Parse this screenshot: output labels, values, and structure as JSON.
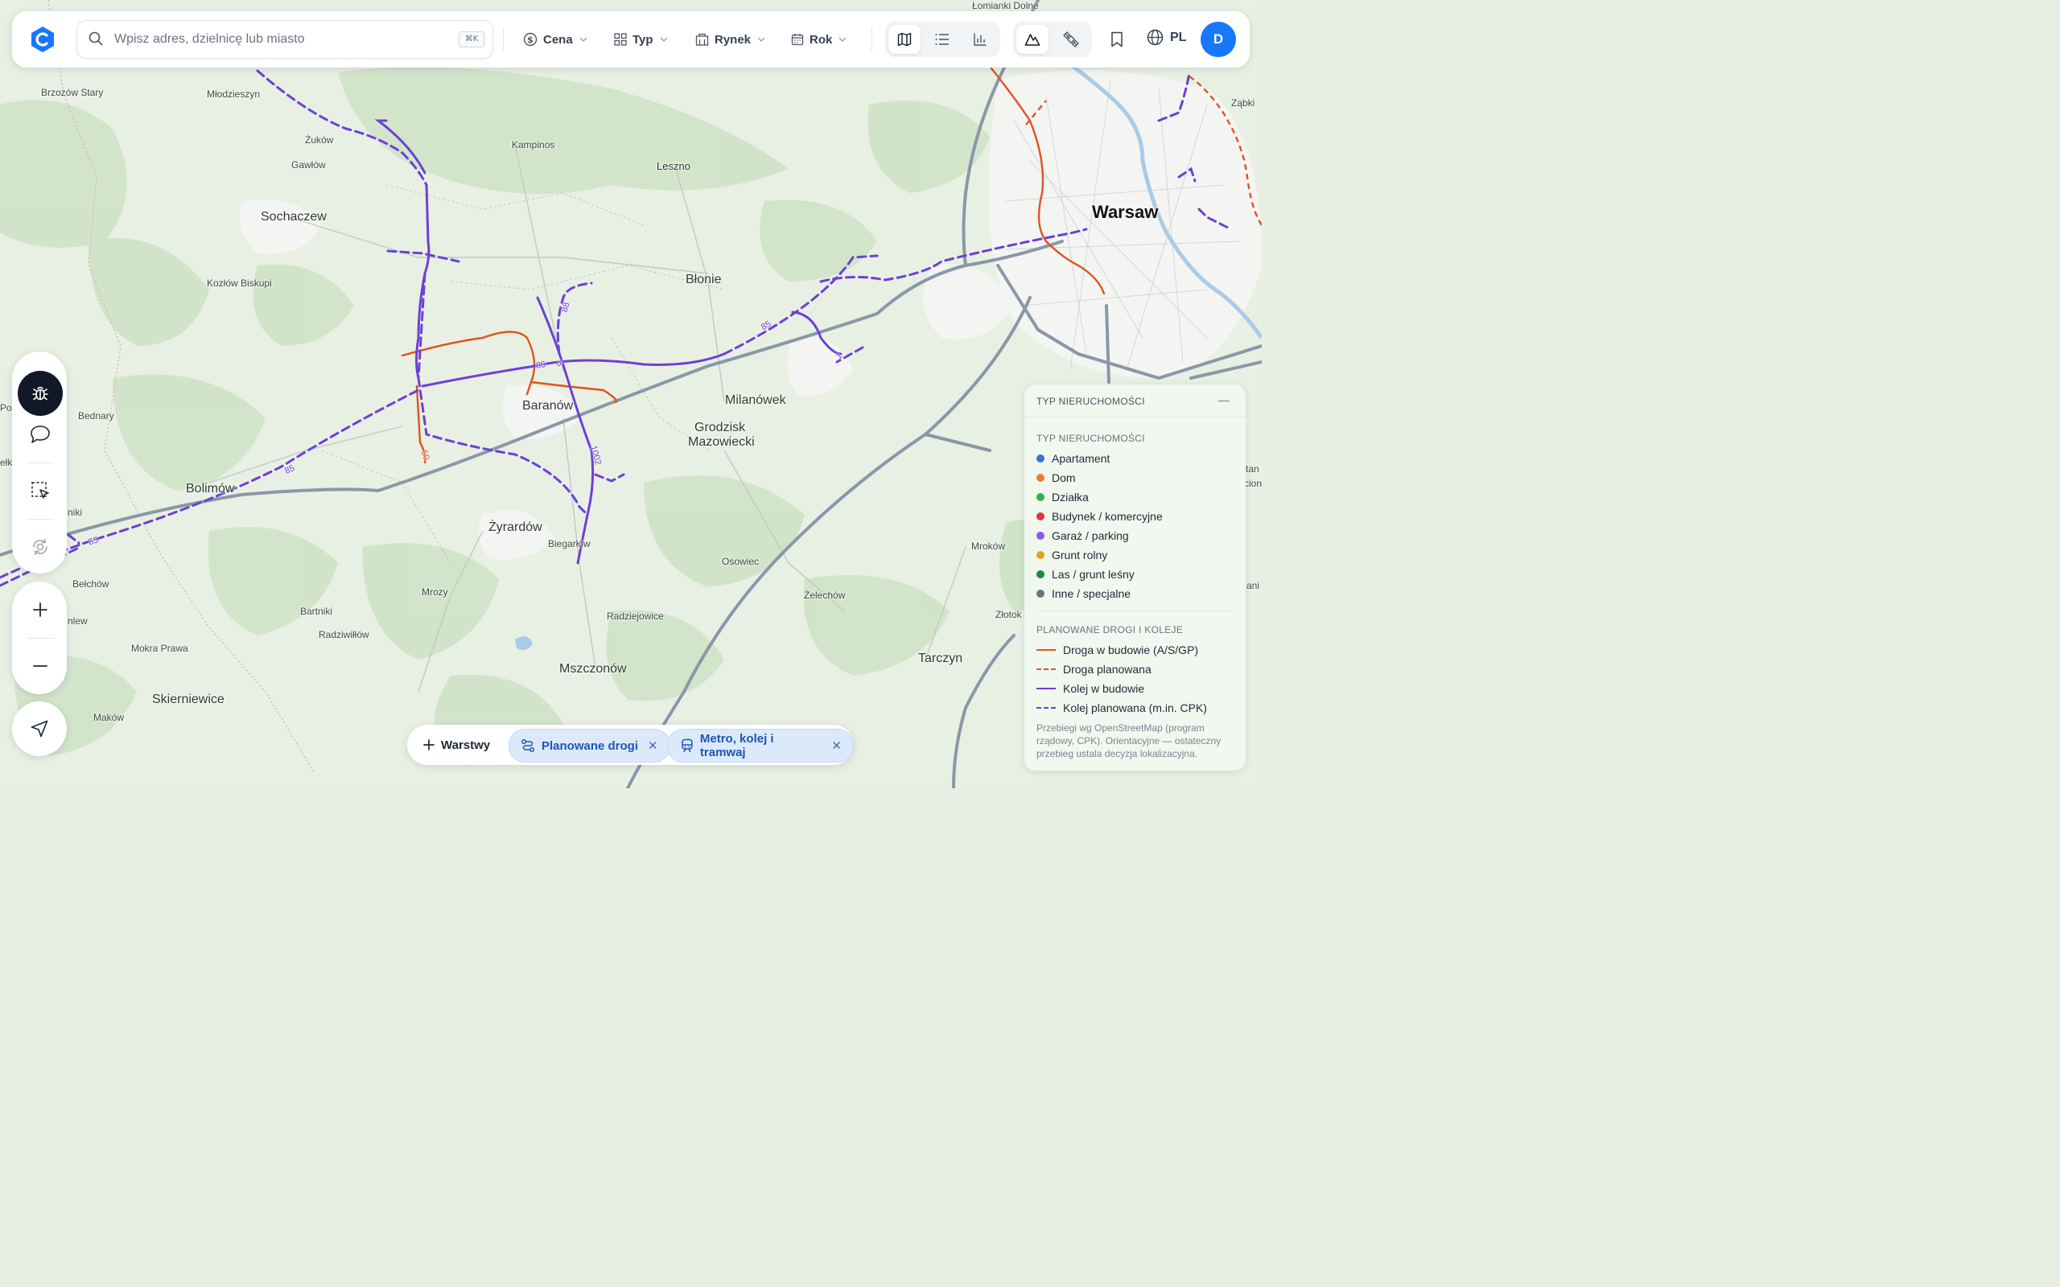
{
  "map": {
    "places": [
      {
        "name": "Warsaw",
        "cls": "city",
        "key": "warsaw"
      },
      {
        "name": "Sochaczew",
        "cls": "big",
        "key": "sochaczew"
      },
      {
        "name": "Błonie",
        "cls": "big",
        "key": "blonie"
      },
      {
        "name": "Baranów",
        "cls": "big",
        "key": "baranow"
      },
      {
        "name": "Żyrardów",
        "cls": "big",
        "key": "zyrardow"
      },
      {
        "name": "Bolimów",
        "cls": "big",
        "key": "bolimow"
      },
      {
        "name": "Milanówek",
        "cls": "big",
        "key": "milanowek"
      },
      {
        "name": "Grodzisk",
        "cls": "big",
        "key": "grodzisk"
      },
      {
        "name": "Mazowiecki",
        "cls": "big",
        "key": "mazowiecki"
      },
      {
        "name": "Mszczonów",
        "cls": "big",
        "key": "mszczonow"
      },
      {
        "name": "Skierniewice",
        "cls": "big",
        "key": "skierniewice"
      },
      {
        "name": "Tarczyn",
        "cls": "big",
        "key": "tarczyn"
      },
      {
        "name": "Leszno",
        "cls": "",
        "key": "leszno"
      },
      {
        "name": "Brzozów Stary",
        "cls": "small",
        "key": "brzozow"
      },
      {
        "name": "Młodzieszyn",
        "cls": "small",
        "key": "mlodzieszyn"
      },
      {
        "name": "Żuków",
        "cls": "small",
        "key": "zukow"
      },
      {
        "name": "Gawłów",
        "cls": "small",
        "key": "gawlow"
      },
      {
        "name": "Kampinos",
        "cls": "small",
        "key": "kampinos"
      },
      {
        "name": "Kozłów Biskupi",
        "cls": "small",
        "key": "kozlow"
      },
      {
        "name": "Bednary",
        "cls": "small",
        "key": "bednary"
      },
      {
        "name": "Biegarłów",
        "cls": "small",
        "key": "biegarlow"
      },
      {
        "name": "Osowiec",
        "cls": "small",
        "key": "osowiec"
      },
      {
        "name": "Mroków",
        "cls": "small",
        "key": "mrokow"
      },
      {
        "name": "Żelechów",
        "cls": "small",
        "key": "zelechow"
      },
      {
        "name": "Złotok",
        "cls": "small",
        "key": "zlotok"
      },
      {
        "name": "Radziejowice",
        "cls": "small",
        "key": "radziejowice"
      },
      {
        "name": "Mrozy",
        "cls": "small",
        "key": "mrozy"
      },
      {
        "name": "Bartniki",
        "cls": "small",
        "key": "bartniki"
      },
      {
        "name": "Radziwiłłów",
        "cls": "small",
        "key": "radziwillow"
      },
      {
        "name": "Bełchów",
        "cls": "small",
        "key": "belchow"
      },
      {
        "name": "Mokra Prawa",
        "cls": "small",
        "key": "mokra"
      },
      {
        "name": "Maków",
        "cls": "small",
        "key": "makow"
      },
      {
        "name": "Ząbki",
        "cls": "small",
        "key": "zabki"
      },
      {
        "name": "Łomianki Dolne",
        "cls": "small",
        "key": "lomianki"
      },
      {
        "name": "Po",
        "cls": "small",
        "key": "po"
      },
      {
        "name": "ełk",
        "cls": "small",
        "key": "elk"
      },
      {
        "name": "niki",
        "cls": "small",
        "key": "niki"
      },
      {
        "name": "nlew",
        "cls": "small",
        "key": "nlew"
      },
      {
        "name": "tan",
        "cls": "small",
        "key": "tan"
      },
      {
        "name": "cion",
        "cls": "small",
        "key": "cion"
      },
      {
        "name": "ani",
        "cls": "small",
        "key": "ani"
      }
    ],
    "road_labels": [
      "85",
      "85",
      "85",
      "85",
      "5",
      "88",
      "1002",
      "50",
      "1"
    ]
  },
  "topbar": {
    "search_placeholder": "Wpisz adres, dzielnicę lub miasto",
    "shortcut": "⌘K",
    "filters": {
      "price": "Cena",
      "type": "Typ",
      "market": "Rynek",
      "year": "Rok"
    },
    "language": "PL",
    "avatar_initial": "D"
  },
  "chips": {
    "layers": "Warstwy",
    "roads": "Planowane drogi",
    "transit": "Metro, kolej i tramwaj"
  },
  "legend": {
    "title": "TYP NIERUCHOMOŚCI",
    "property_heading": "TYP NIERUCHOMOŚCI",
    "property_types": [
      {
        "label": "Apartament",
        "color": "#3b6fd8"
      },
      {
        "label": "Dom",
        "color": "#ef7d2b"
      },
      {
        "label": "Działka",
        "color": "#2fb24f"
      },
      {
        "label": "Budynek / komercyjne",
        "color": "#e0353c"
      },
      {
        "label": "Garaż / parking",
        "color": "#8e5ae8"
      },
      {
        "label": "Grunt rolny",
        "color": "#e0a423"
      },
      {
        "label": "Las / grunt leśny",
        "color": "#1d8a3a"
      },
      {
        "label": "Inne / specjalne",
        "color": "#6b7280"
      }
    ],
    "infra_heading": "PLANOWANE DROGI I KOLEJE",
    "infra": [
      {
        "label": "Droga w budowie (A/S/GP)",
        "color": "#e0531f",
        "style": "solid"
      },
      {
        "label": "Droga planowana",
        "color": "#e0531f",
        "style": "dashed"
      },
      {
        "label": "Kolej w budowie",
        "color": "#6f3fd6",
        "style": "solid"
      },
      {
        "label": "Kolej planowana (m.in. CPK)",
        "color": "#6f3fd6",
        "style": "dashed"
      }
    ],
    "note": "Przebiegi wg OpenStreetMap (program rządowy, CPK). Orientacyjne — ostateczny przebieg ustala decyzja lokalizacyjna."
  },
  "colors": {
    "rail": "#6f3fd6",
    "road": "#e0531f",
    "highway": "#8a97a8",
    "accent": "#1677ff"
  }
}
